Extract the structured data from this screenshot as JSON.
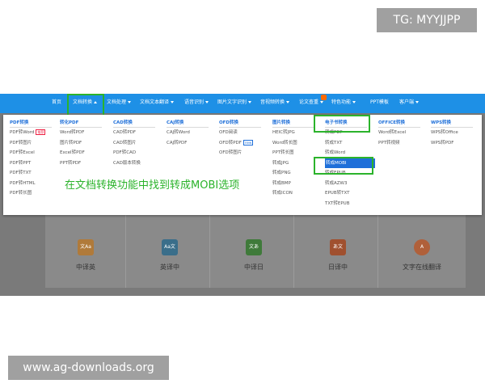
{
  "watermark": {
    "tg": "TG: MYYJJPP",
    "site": "www.ag-downloads.org"
  },
  "nav": {
    "items": [
      {
        "label": "首页",
        "caret": false
      },
      {
        "label": "文档转换",
        "caret": true,
        "open": true
      },
      {
        "label": "文档处理",
        "caret": true
      },
      {
        "label": "文档文本翻译",
        "caret": true
      },
      {
        "label": "语音识别",
        "caret": true
      },
      {
        "label": "图片文字识别",
        "caret": true
      },
      {
        "label": "音视频转换",
        "caret": true
      },
      {
        "label": "论文查重",
        "caret": true
      },
      {
        "label": "特色功能",
        "caret": true
      },
      {
        "label": "PPT模板",
        "caret": false
      },
      {
        "label": "客户端",
        "caret": true
      }
    ]
  },
  "dropdown": {
    "columns": [
      {
        "head": "PDF转换",
        "items": [
          "PDF转Word",
          "PDF转图片",
          "PDF转Excel",
          "PDF转PPT",
          "PDF转TXT",
          "PDF转HTML",
          "PDF转长图"
        ],
        "badge_index": 0,
        "badge": "推荐"
      },
      {
        "head": "转化PDF",
        "items": [
          "Word转PDF",
          "图片转PDF",
          "Excel转PDF",
          "PPT转PDF"
        ]
      },
      {
        "head": "CAD转换",
        "items": [
          "CAD转PDF",
          "CAD转图片",
          "PDF转CAD",
          "CAD版本转换"
        ]
      },
      {
        "head": "CAJ转换",
        "items": [
          "CAJ转Word",
          "CAJ转PDF"
        ]
      },
      {
        "head": "OFD转换",
        "items": [
          "OFD阅读",
          "OFD转PDF",
          "OFD转图片"
        ],
        "badge_index": 1,
        "badge": "new"
      },
      {
        "head": "图片转换",
        "items": [
          "HEIC转JPG",
          "Word转长图",
          "PPT转长图",
          "转成JPG",
          "转成PNG",
          "转成BMP",
          "转成ICON"
        ]
      },
      {
        "head": "电子书转换",
        "items": [
          "转成PDF",
          "转成TXT",
          "转成Word",
          "转成MOBI",
          "转成EPUB",
          "转成AZW3",
          "EPUB转TXT",
          "TXT转EPUB"
        ],
        "active_index": 3
      },
      {
        "head": "OFFICE转换",
        "items": [
          "Word转Excel",
          "PPT转视频"
        ]
      },
      {
        "head": "WPS转换",
        "items": [
          "WPS转Office",
          "WPS转PDF"
        ]
      }
    ],
    "instruction": "在文档转换功能中找到转成MOBI选项"
  },
  "translate": {
    "cards": [
      {
        "label": "中译英",
        "icon": "文Aa",
        "color": "#b07a3a"
      },
      {
        "label": "英译中",
        "icon": "Aa文",
        "color": "#3a6e8a"
      },
      {
        "label": "中译日",
        "icon": "文あ",
        "color": "#3f7a3a"
      },
      {
        "label": "日译中",
        "icon": "あ文",
        "color": "#a0502f"
      },
      {
        "label": "文字在线翻译",
        "icon": "A",
        "color": "#b0603a"
      }
    ]
  },
  "colors": {
    "nav": "#1e90e6",
    "highlight": "#2bb32b",
    "active": "#1e6fd9"
  }
}
